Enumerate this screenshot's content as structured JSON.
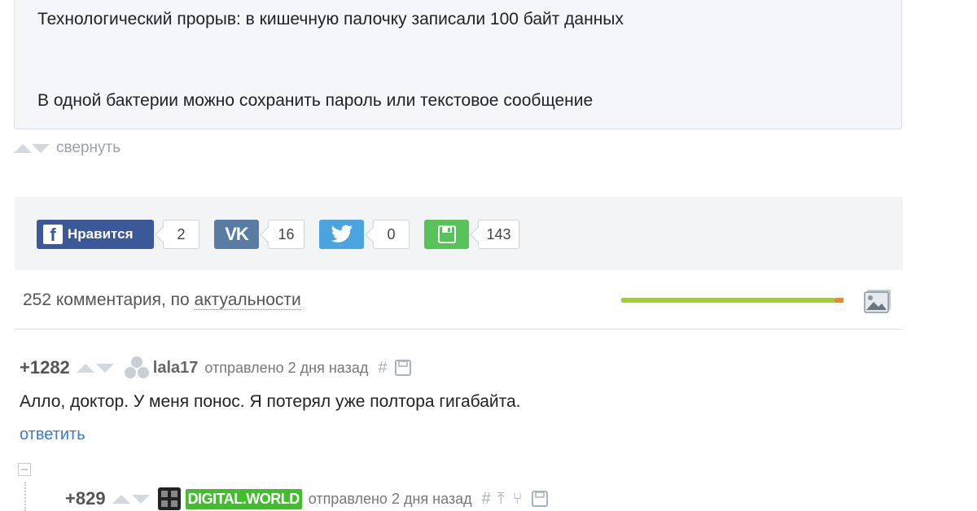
{
  "post": {
    "line1": "Технологический прорыв: в кишечную палочку записали 100 байт данных",
    "line2": "В одной бактерии можно сохранить пароль или текстовое сообщение"
  },
  "collapse": {
    "label": "свернуть"
  },
  "share": {
    "facebook": {
      "label": "Нравится",
      "count": "2",
      "color": "#3b5998"
    },
    "vk": {
      "label": "VK",
      "count": "16",
      "color": "#587ca3"
    },
    "twitter": {
      "count": "0",
      "color": "#4ba3e0"
    },
    "save": {
      "count": "143",
      "color": "#58c25a"
    }
  },
  "comments_header": {
    "count_text": "252 комментария, по ",
    "sort_label": "актуальности",
    "rating_positive_fraction": 0.96,
    "colors": {
      "positive": "#a2cc3a",
      "negative": "#f0862e"
    }
  },
  "comments": [
    {
      "score": "+1282",
      "username": "lala17",
      "meta": "отправлено 2 дня назад",
      "hash": "#",
      "text": "Алло, доктор. У меня понос. Я потерял уже полтора гигабайта.",
      "reply_label": "ответить"
    },
    {
      "score": "+829",
      "username": "DIGITAL.WORLD",
      "meta": "отправлено 2 дня назад",
      "hash": "#",
      "username_badge_color": "#3fbf2a"
    }
  ]
}
